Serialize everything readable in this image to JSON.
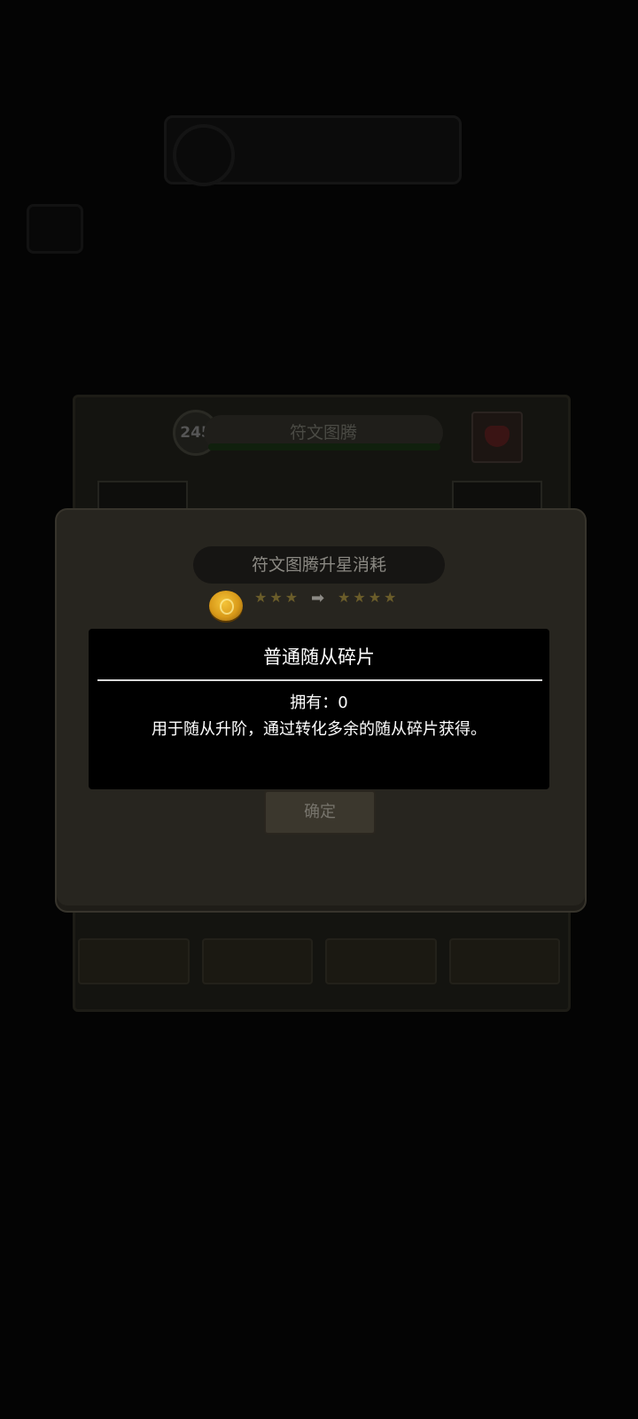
{
  "background": {
    "level_badge": "245",
    "panel_title": "符文图腾",
    "tabs": [
      "",
      "",
      "",
      ""
    ]
  },
  "dialog": {
    "title": "符文图腾升星消耗",
    "current_stars": 3,
    "target_stars": 4,
    "confirm_label": "确定"
  },
  "tooltip": {
    "title": "普通随从碎片",
    "owned_label": "拥有：",
    "owned_value": "0",
    "description": "用于随从升阶，通过转化多余的随从碎片获得。"
  },
  "icons": {
    "currency": "gold-coin-icon",
    "upgrade_arrow": "arrow-right-icon",
    "star": "star-icon"
  }
}
